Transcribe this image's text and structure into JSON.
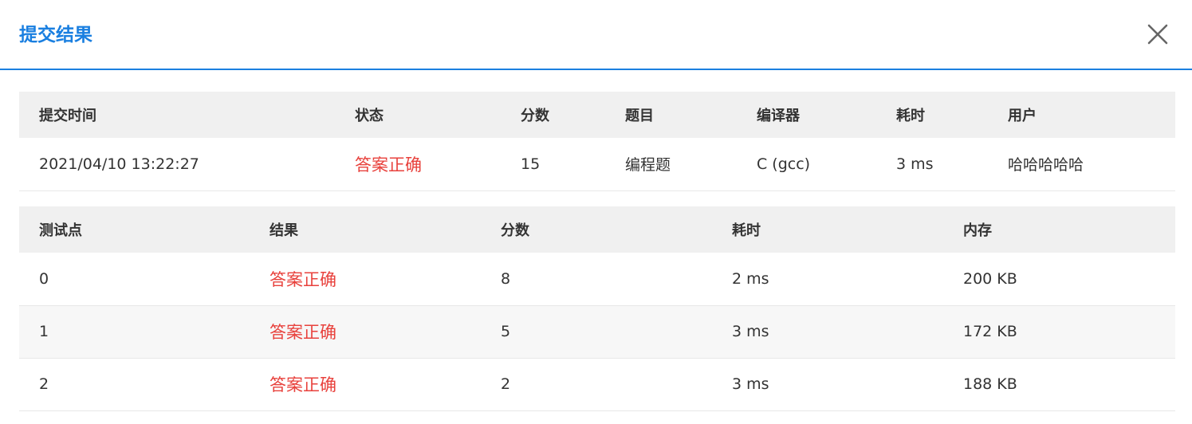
{
  "dialog": {
    "title": "提交结果"
  },
  "summary": {
    "headers": [
      "提交时间",
      "状态",
      "分数",
      "题目",
      "编译器",
      "耗时",
      "用户"
    ],
    "row": {
      "time": "2021/04/10 13:22:27",
      "status": "答案正确",
      "score": "15",
      "problem": "编程题",
      "compiler": "C (gcc)",
      "duration": "3 ms",
      "user": "哈哈哈哈哈"
    }
  },
  "cases": {
    "headers": [
      "测试点",
      "结果",
      "分数",
      "耗时",
      "内存"
    ],
    "rows": [
      {
        "id": "0",
        "result": "答案正确",
        "score": "8",
        "duration": "2 ms",
        "memory": "200 KB"
      },
      {
        "id": "1",
        "result": "答案正确",
        "score": "5",
        "duration": "3 ms",
        "memory": "172 KB"
      },
      {
        "id": "2",
        "result": "答案正确",
        "score": "2",
        "duration": "3 ms",
        "memory": "188 KB"
      }
    ]
  },
  "colors": {
    "accent": "#1a7fe0",
    "success_text": "#e8413c",
    "header_bg": "#f0f0f0"
  },
  "icons": {
    "close": "close-icon"
  }
}
